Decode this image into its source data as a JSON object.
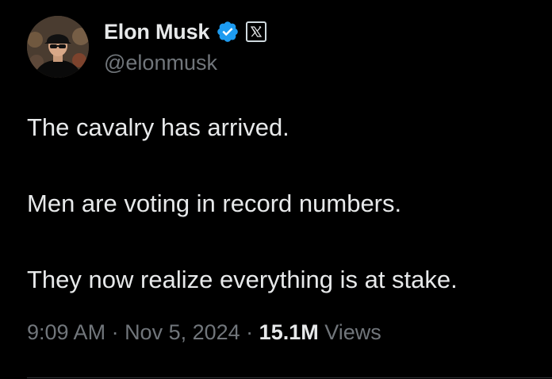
{
  "author": {
    "display_name": "Elon Musk",
    "handle": "@elonmusk",
    "avatar_icon": "profile-photo",
    "verified_icon": "verified-badge-icon",
    "verified_color": "#1d9bf0",
    "affiliate_icon": "x-logo-icon"
  },
  "tweet": {
    "lines": [
      "The cavalry has arrived.",
      "Men are voting in record numbers.",
      "They now realize everything is at stake."
    ]
  },
  "meta": {
    "time": "9:09 AM",
    "sep1": " · ",
    "date": "Nov 5, 2024",
    "sep2": " · ",
    "views_count": "15.1M",
    "views_label": "Views"
  },
  "colors": {
    "background": "#000000",
    "primary_text": "#e7e9ea",
    "secondary_text": "#71767b",
    "divider": "#2f3336"
  }
}
